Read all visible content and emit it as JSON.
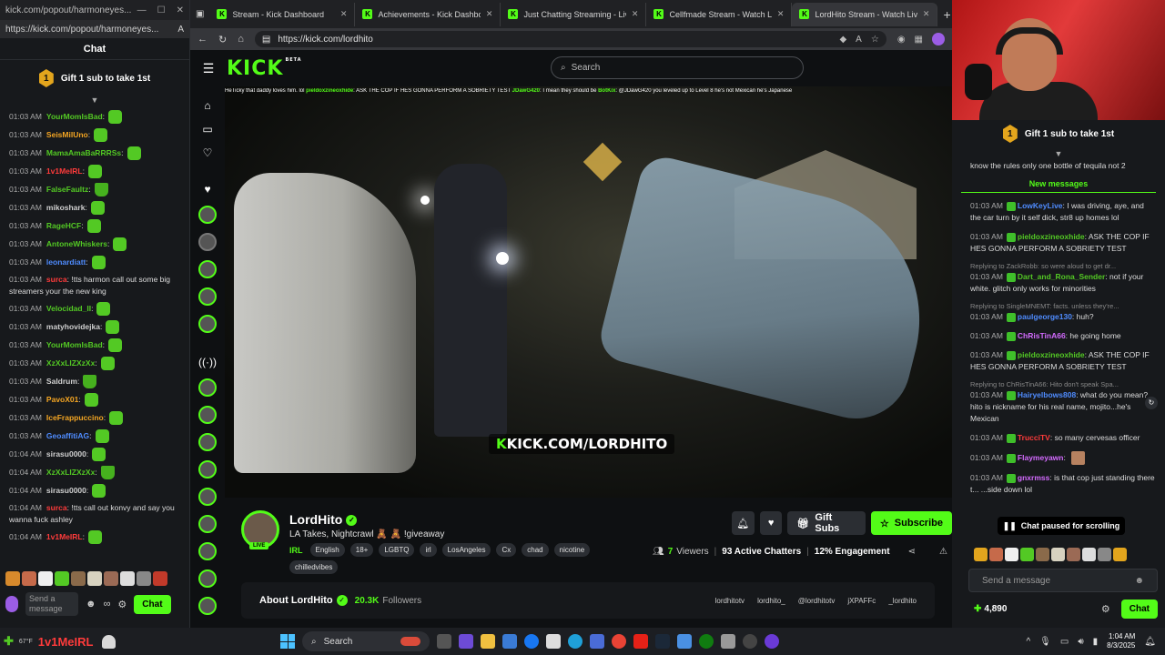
{
  "popout": {
    "window_title": "kick.com/popout/harmoneyes...",
    "url": "https://kick.com/popout/harmoneyes...",
    "header": "Chat",
    "gift_label": "Gift 1 sub to take 1st",
    "gift_rank": "1",
    "messages": [
      {
        "time": "01:03 AM",
        "user": "YourMomIsBad",
        "text": "",
        "color": "#53c924"
      },
      {
        "time": "01:03 AM",
        "user": "SeisMilUno",
        "text": "",
        "color": "#f5a623"
      },
      {
        "time": "01:03 AM",
        "user": "MamaAmaBaRRRSs",
        "text": "",
        "color": "#53c924"
      },
      {
        "time": "01:03 AM",
        "user": "1v1MeIRL",
        "text": "",
        "color": "#ff3b3b"
      },
      {
        "time": "01:03 AM",
        "user": "FalseFaultz",
        "text": "",
        "color": "#53c924"
      },
      {
        "time": "01:03 AM",
        "user": "mikoshark",
        "text": "",
        "color": "#cfcfcf"
      },
      {
        "time": "01:03 AM",
        "user": "RageHCF",
        "text": "",
        "color": "#53c924"
      },
      {
        "time": "01:03 AM",
        "user": "AntoneWhiskers",
        "text": "",
        "color": "#53c924"
      },
      {
        "time": "01:03 AM",
        "user": "leonardiatt",
        "text": "",
        "color": "#4f8cff"
      },
      {
        "time": "01:03 AM",
        "user": "surca",
        "text": "!tts harmon call out some big streamers your the new king",
        "color": "#ff3b3b"
      },
      {
        "time": "01:03 AM",
        "user": "Velocidad_II",
        "text": "",
        "color": "#53c924"
      },
      {
        "time": "01:03 AM",
        "user": "matyhovidejka",
        "text": "",
        "color": "#cfcfcf"
      },
      {
        "time": "01:03 AM",
        "user": "YourMomIsBad",
        "text": "",
        "color": "#53c924"
      },
      {
        "time": "01:03 AM",
        "user": "XzXxLIZXzXx",
        "text": "",
        "color": "#53c924"
      },
      {
        "time": "01:03 AM",
        "user": "Saldrum",
        "text": "",
        "color": "#cfcfcf"
      },
      {
        "time": "01:03 AM",
        "user": "PavoX01",
        "text": "",
        "color": "#f5a623"
      },
      {
        "time": "01:03 AM",
        "user": "IceFrappuccino",
        "text": "",
        "color": "#f5a623"
      },
      {
        "time": "01:03 AM",
        "user": "GeoaffitiAG",
        "text": "",
        "color": "#4f8cff"
      },
      {
        "time": "01:04 AM",
        "user": "sirasu0000",
        "text": "",
        "color": "#cfcfcf"
      },
      {
        "time": "01:04 AM",
        "user": "XzXxLIZXzXx",
        "text": "",
        "color": "#53c924"
      },
      {
        "time": "01:04 AM",
        "user": "sirasu0000",
        "text": "",
        "color": "#cfcfcf"
      },
      {
        "time": "01:04 AM",
        "user": "surca",
        "text": "!tts call out konvy and say you wanna fuck ashley",
        "color": "#ff3b3b"
      },
      {
        "time": "01:04 AM",
        "user": "1v1MeIRL",
        "text": "",
        "color": "#ff3b3b"
      }
    ],
    "input_placeholder": "Send a message",
    "chat_button": "Chat"
  },
  "browser": {
    "tabs": [
      {
        "label": "Stream - Kick Dashboard",
        "active": false
      },
      {
        "label": "Achievements - Kick Dashboard",
        "active": false
      },
      {
        "label": "Just Chatting Streaming - Live Str...",
        "active": false
      },
      {
        "label": "Cellfmade Stream - Watch Li...",
        "active": false
      },
      {
        "label": "LordHito Stream - Watch Live...",
        "active": true
      }
    ],
    "url": "https://kick.com/lordhito"
  },
  "kick": {
    "logo": "KICK",
    "beta": "BETA",
    "search_placeholder": "Search"
  },
  "video": {
    "ticker_parts": [
      {
        "user": "",
        "text": "HeTicky that daddy loves him. lol"
      },
      {
        "user": "pieldoxzineoxhide",
        "text": ": ASK THE COP IF HES GONNA PERFORM A SOBRIETY TEST"
      },
      {
        "user": "JDawG420",
        "text": ": I mean they should be"
      },
      {
        "user": "BotKix",
        "text": ": @JDawG420 you leveled up to Level 8"
      },
      {
        "user": "",
        "text": "he's not Mexican he's Japanese"
      }
    ],
    "watermark_prefix": "K",
    "watermark": "KICK.COM/LORDHITO"
  },
  "stream": {
    "name": "LordHito",
    "title": "LA Takes, Nightcrawl 🧸 🧸 !giveaway",
    "category": "IRL",
    "tags": [
      "English",
      "18+",
      "LGBTQ",
      "irl",
      "LosAngeles",
      "Cx",
      "chad",
      "nicotine",
      "chilledvibes"
    ],
    "live_label": "LIVE",
    "gift_subs": "Gift Subs",
    "subscribe": "Subscribe",
    "viewers_count": "7",
    "viewers_label": "Viewers",
    "chatters": "93 Active Chatters",
    "engagement": "12% Engagement",
    "about_title": "About LordHito",
    "followers_count": "20.3K",
    "followers_label": "Followers",
    "socials": [
      "lordhitotv",
      "lordhito_",
      "@lordhitotv",
      "jXPAFFc",
      "_lordhito"
    ]
  },
  "right_chat": {
    "gift_label": "Gift 1 sub to take 1st",
    "gift_rank": "1",
    "top_line": "know the rules only one bottle of tequila not 2",
    "new_messages": "New messages",
    "messages": [
      {
        "reply": "",
        "time": "01:03 AM",
        "user": "LowKeyLive",
        "text": "I was driving, aye, and the car turn by it self dick, str8 up homes lol",
        "color": "#4f8cff"
      },
      {
        "reply": "",
        "time": "01:03 AM",
        "user": "pieldoxzineoxhide",
        "text": "ASK THE COP IF HES GONNA PERFORM A SOBRIETY TEST",
        "color": "#53c924"
      },
      {
        "reply": "Replying to ZackRobb: so were aloud to get dr...",
        "time": "01:03 AM",
        "user": "Dart_and_Rona_Sender",
        "text": "not if your white. glitch only works for minorities",
        "color": "#53c924"
      },
      {
        "reply": "Replying to SingleMNEMT: facts. unless they're...",
        "time": "01:03 AM",
        "user": "paulgeorge130",
        "text": "huh?",
        "color": "#4f8cff"
      },
      {
        "reply": "",
        "time": "01:03 AM",
        "user": "ChRisTinA66",
        "text": "he going home",
        "color": "#d46bff"
      },
      {
        "reply": "",
        "time": "01:03 AM",
        "user": "pieldoxzineoxhide",
        "text": "ASK THE COP IF HES GONNA PERFORM A SOBRIETY TEST",
        "color": "#53c924"
      },
      {
        "reply": "Replying to ChRisTinA66: Hito don't speak Spa...",
        "time": "01:03 AM",
        "user": "Hairyelbows808",
        "text": "what do you mean? hito is nickname for his real name, mojito...he's Mexican",
        "color": "#4f8cff"
      },
      {
        "reply": "",
        "time": "01:03 AM",
        "user": "TrucciTV",
        "text": "so many cervesas officer",
        "color": "#ff3b3b"
      },
      {
        "reply": "",
        "time": "01:03 AM",
        "user": "Flaymeyawn",
        "text": "",
        "color": "#d46bff"
      },
      {
        "reply": "",
        "time": "01:03 AM",
        "user": "gnxrmss",
        "text": "is that cop just standing there t... ...side down lol",
        "color": "#d46bff"
      }
    ],
    "paused_label": "Chat paused for scrolling",
    "input_placeholder": "Send a message",
    "points": "4,890",
    "chat_button": "Chat"
  },
  "taskbar": {
    "overlay_name": "1v1MeIRL",
    "weather": "67°F",
    "search_label": "Search",
    "time": "1:04 AM",
    "date": "8/3/2025"
  }
}
